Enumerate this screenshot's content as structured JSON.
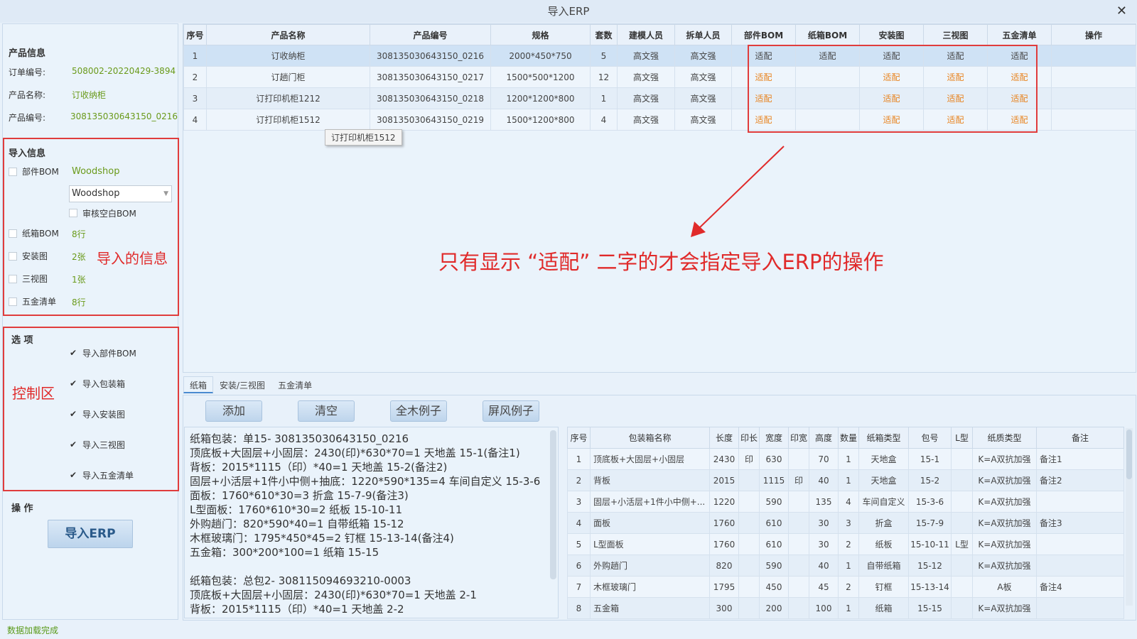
{
  "window": {
    "title": "导入ERP",
    "close_icon": "close-icon"
  },
  "product_info": {
    "title": "产品信息",
    "order_label": "订单编号:",
    "order_value": "508002-20220429-3894",
    "name_label": "产品名称:",
    "name_value": "订收纳柜",
    "code_label": "产品编号:",
    "code_value": "308135030643150_0216"
  },
  "import_info": {
    "title": "导入信息",
    "items": [
      {
        "label": "部件BOM",
        "value": "Woodshop"
      },
      {
        "label": "纸箱BOM",
        "value": "8行"
      },
      {
        "label": "安装图",
        "value": "2张"
      },
      {
        "label": "三视图",
        "value": "1张"
      },
      {
        "label": "五金清单",
        "value": "8行"
      }
    ],
    "bom_select": "Woodshop",
    "audit_blank_bom": "审核空白BOM",
    "annotation": "导入的信息"
  },
  "options": {
    "title": "选 项",
    "items": [
      "导入部件BOM",
      "导入包装箱",
      "导入安装图",
      "导入三视图",
      "导入五金清单"
    ],
    "annotation": "控制区"
  },
  "operation": {
    "title": "操 作",
    "import_button": "导入ERP"
  },
  "top_table": {
    "headers": [
      "序号",
      "产品名称",
      "产品编号",
      "规格",
      "套数",
      "建模人员",
      "拆单人员",
      "部件BOM",
      "纸箱BOM",
      "安装图",
      "三视图",
      "五金清单",
      "操作"
    ],
    "rows": [
      [
        "1",
        "订收纳柜",
        "308135030643150_0216",
        "2000*450*750",
        "5",
        "高文强",
        "高文强",
        "适配",
        "适配",
        "适配",
        "适配",
        "适配",
        ""
      ],
      [
        "2",
        "订趟门柜",
        "308135030643150_0217",
        "1500*500*1200",
        "12",
        "高文强",
        "高文强",
        "适配",
        "",
        "适配",
        "适配",
        "适配",
        ""
      ],
      [
        "3",
        "订打印机柜1212",
        "308135030643150_0218",
        "1200*1200*800",
        "1",
        "高文强",
        "高文强",
        "适配",
        "",
        "适配",
        "适配",
        "适配",
        ""
      ],
      [
        "4",
        "订打印机柜1512",
        "308135030643150_0219",
        "1500*1200*800",
        "4",
        "高文强",
        "高文强",
        "适配",
        "",
        "适配",
        "适配",
        "适配",
        ""
      ]
    ],
    "tooltip": "订打印机柜1512"
  },
  "annotation_main": "只有显示 “适配” 二字的才会指定导入ERP的操作",
  "colors": {
    "annotation_red": "#e02a2a",
    "adapt_orange": "#e8831e",
    "value_green": "#6a9a1a"
  },
  "tabs": [
    "纸箱",
    "安装/三视图",
    "五金清单"
  ],
  "sub_buttons": [
    "添加",
    "清空",
    "全木例子",
    "屏风例子"
  ],
  "text_lines": [
    "纸箱包装：单15- 308135030643150_0216",
    "顶底板+大固层+小固层：2430(印)*630*70=1 天地盖 15-1(备注1)",
    "背板：2015*1115（印）*40=1 天地盖 15-2(备注2)",
    "固层+小活层+1件小中侧+抽底：1220*590*135=4 车间自定义  15-3-6",
    "面板：1760*610*30=3  折盒  15-7-9(备注3)",
    "L型面板：1760*610*30=2 纸板 15-10-11",
    "外购趟门：820*590*40=1 自带纸箱 15-12",
    "木框玻璃门：1795*450*45=2 钉框 15-13-14(备注4)",
    "五金箱：300*200*100=1 纸箱 15-15",
    "",
    "纸箱包装：总包2- 308115094693210-0003",
    "顶底板+大固层+小固层：2430(印)*630*70=1 天地盖 2-1",
    "背板：2015*1115（印）*40=1 天地盖 2-2"
  ],
  "box_table": {
    "headers": [
      "序号",
      "包装箱名称",
      "长度",
      "印长",
      "宽度",
      "印宽",
      "高度",
      "数量",
      "纸箱类型",
      "包号",
      "L型",
      "纸质类型",
      "备注"
    ],
    "rows": [
      [
        "1",
        "顶底板+大固层+小固层",
        "2430",
        "印",
        "630",
        "",
        "70",
        "1",
        "天地盒",
        "15-1",
        "",
        "K=A双抗加强",
        "备注1"
      ],
      [
        "2",
        "背板",
        "2015",
        "",
        "1115",
        "印",
        "40",
        "1",
        "天地盒",
        "15-2",
        "",
        "K=A双抗加强",
        "备注2"
      ],
      [
        "3",
        "固层+小活层+1件小中侧+...",
        "1220",
        "",
        "590",
        "",
        "135",
        "4",
        "车间自定义",
        "15-3-6",
        "",
        "K=A双抗加强",
        ""
      ],
      [
        "4",
        "面板",
        "1760",
        "",
        "610",
        "",
        "30",
        "3",
        "折盒",
        "15-7-9",
        "",
        "K=A双抗加强",
        "备注3"
      ],
      [
        "5",
        "L型面板",
        "1760",
        "",
        "610",
        "",
        "30",
        "2",
        "纸板",
        "15-10-11",
        "L型",
        "K=A双抗加强",
        ""
      ],
      [
        "6",
        "外购趟门",
        "820",
        "",
        "590",
        "",
        "40",
        "1",
        "自带纸箱",
        "15-12",
        "",
        "K=A双抗加强",
        ""
      ],
      [
        "7",
        "木框玻璃门",
        "1795",
        "",
        "450",
        "",
        "45",
        "2",
        "钉框",
        "15-13-14",
        "",
        "A板",
        "备注4"
      ],
      [
        "8",
        "五金箱",
        "300",
        "",
        "200",
        "",
        "100",
        "1",
        "纸箱",
        "15-15",
        "",
        "K=A双抗加强",
        ""
      ]
    ]
  },
  "status": "数据加载完成"
}
